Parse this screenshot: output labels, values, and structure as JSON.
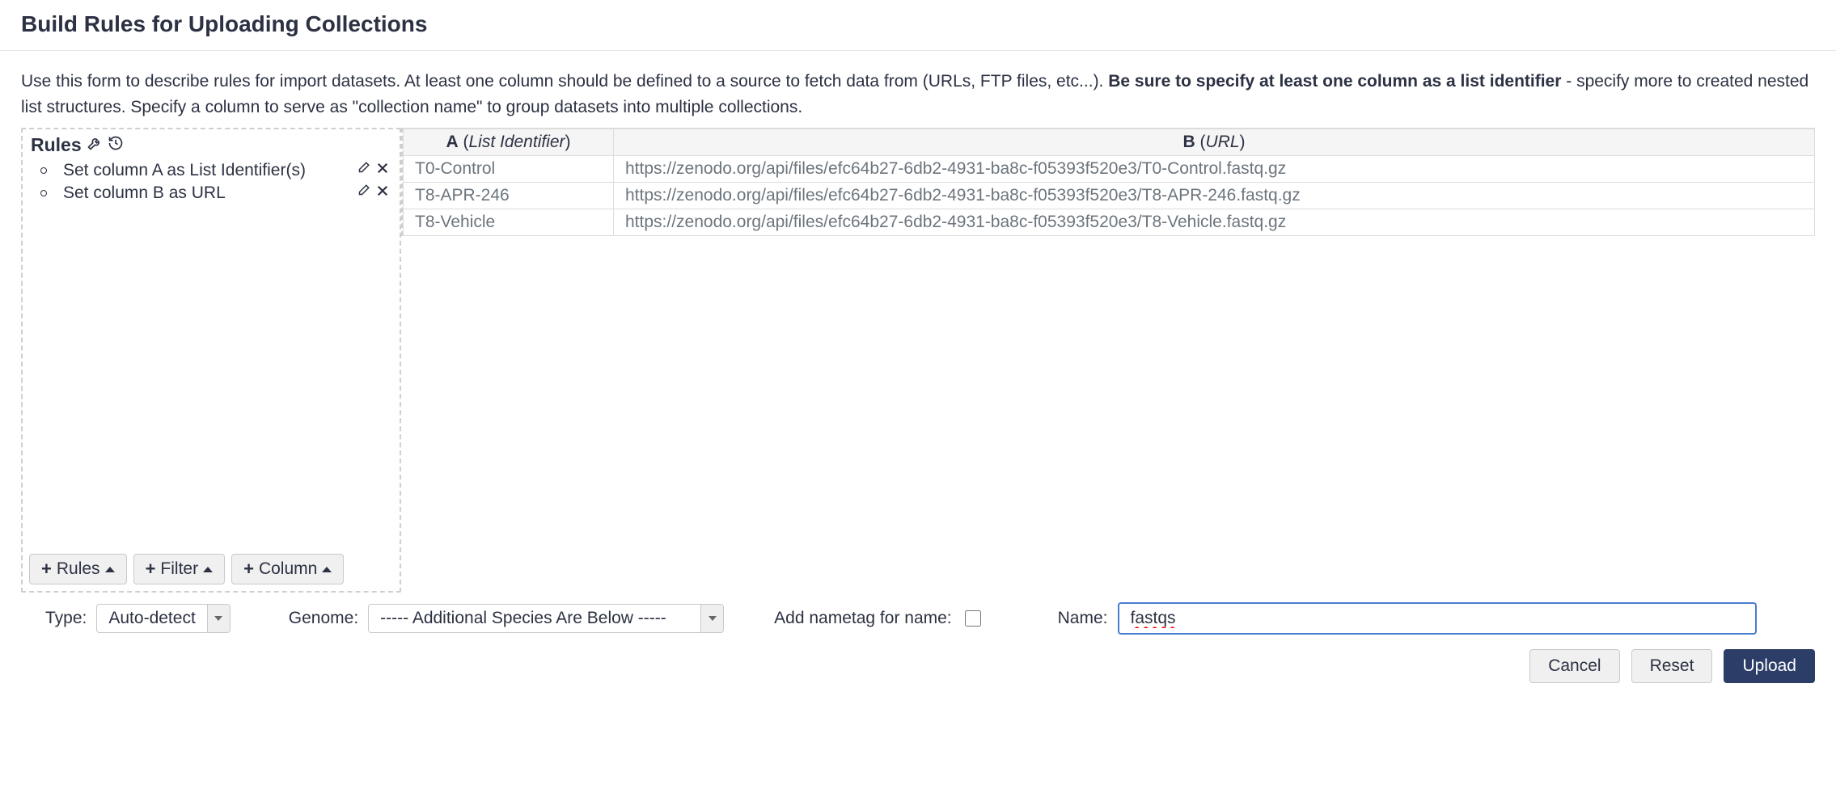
{
  "title": "Build Rules for Uploading Collections",
  "description": {
    "part1": "Use this form to describe rules for import datasets. At least one column should be defined to a source to fetch data from (URLs, FTP files, etc...). ",
    "bold": "Be sure to specify at least one column as a list identifier",
    "part2": " - specify more to created nested list structures. Specify a column to serve as \"collection name\" to group datasets into multiple collections."
  },
  "rules": {
    "heading": "Rules",
    "items": [
      "Set column A as List Identifier(s)",
      "Set column B as URL"
    ],
    "buttons": {
      "rules": "Rules",
      "filter": "Filter",
      "column": "Column"
    }
  },
  "table": {
    "headers": {
      "a_letter": "A",
      "a_type": "List Identifier",
      "b_letter": "B",
      "b_type": "URL"
    },
    "rows": [
      {
        "a": "T0-Control",
        "b": "https://zenodo.org/api/files/efc64b27-6db2-4931-ba8c-f05393f520e3/T0-Control.fastq.gz"
      },
      {
        "a": "T8-APR-246",
        "b": "https://zenodo.org/api/files/efc64b27-6db2-4931-ba8c-f05393f520e3/T8-APR-246.fastq.gz"
      },
      {
        "a": "T8-Vehicle",
        "b": "https://zenodo.org/api/files/efc64b27-6db2-4931-ba8c-f05393f520e3/T8-Vehicle.fastq.gz"
      }
    ]
  },
  "footer": {
    "type_label": "Type:",
    "type_value": "Auto-detect",
    "genome_label": "Genome:",
    "genome_value": "----- Additional Species Are Below -----",
    "nametag_label": "Add nametag for name:",
    "name_label": "Name:",
    "name_value": "fastqs"
  },
  "actions": {
    "cancel": "Cancel",
    "reset": "Reset",
    "upload": "Upload"
  }
}
